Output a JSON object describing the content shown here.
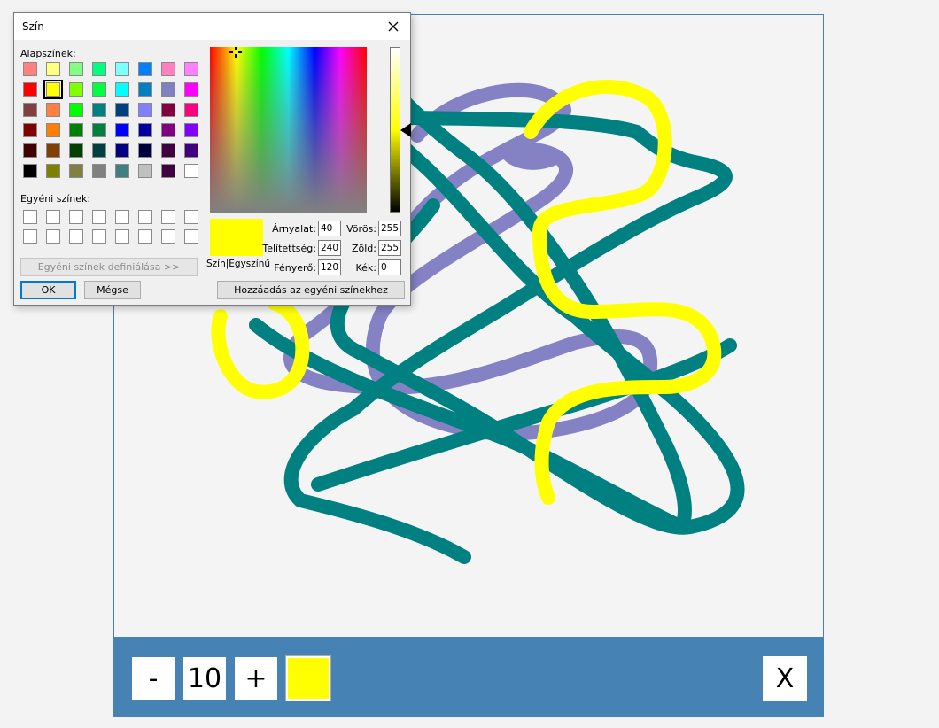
{
  "app": {
    "brush_size": "10",
    "minus_label": "-",
    "plus_label": "+",
    "close_label": "X",
    "current_color": "#ffff00",
    "stroke_colors": {
      "teal": "#008080",
      "purple": "#8482c4",
      "yellow": "#ffff00"
    },
    "toolbar_color": "#4682b4"
  },
  "dialog": {
    "title": "Szín",
    "basic_colors_label": "Alapszínek:",
    "custom_colors_label": "Egyéni színek:",
    "define_custom_button": "Egyéni színek definiálása >>",
    "ok_button": "OK",
    "cancel_button": "Mégse",
    "add_custom_button": "Hozzáadás az egyéni színekhez",
    "preview_label": "Szín|Egyszínű",
    "fields": {
      "hue_label": "Árnyalat:",
      "hue": "40",
      "sat_label": "Telítettség:",
      "sat": "240",
      "lum_label": "Fényerő:",
      "lum": "120",
      "red_label": "Vörös:",
      "red": "255",
      "green_label": "Zöld:",
      "green": "255",
      "blue_label": "Kék:",
      "blue": "0"
    },
    "basic_colors": [
      [
        "#ff8080",
        "#ffff80",
        "#80ff80",
        "#00ff80",
        "#80ffff",
        "#0080ff",
        "#ff80c0",
        "#ff80ff"
      ],
      [
        "#ff0000",
        "#ffff00",
        "#80ff00",
        "#00ff40",
        "#00ffff",
        "#0080c0",
        "#8080c0",
        "#ff00ff"
      ],
      [
        "#804040",
        "#ff8040",
        "#00ff00",
        "#008080",
        "#004080",
        "#8080ff",
        "#800040",
        "#ff0080"
      ],
      [
        "#800000",
        "#ff8000",
        "#008000",
        "#008040",
        "#0000ff",
        "#0000a0",
        "#800080",
        "#8000ff"
      ],
      [
        "#400000",
        "#804000",
        "#004000",
        "#004040",
        "#000080",
        "#000040",
        "#400040",
        "#400080"
      ],
      [
        "#000000",
        "#808000",
        "#808040",
        "#808080",
        "#408080",
        "#c0c0c0",
        "#400040",
        "#ffffff"
      ]
    ],
    "selected_basic_color": "#ffff00"
  }
}
